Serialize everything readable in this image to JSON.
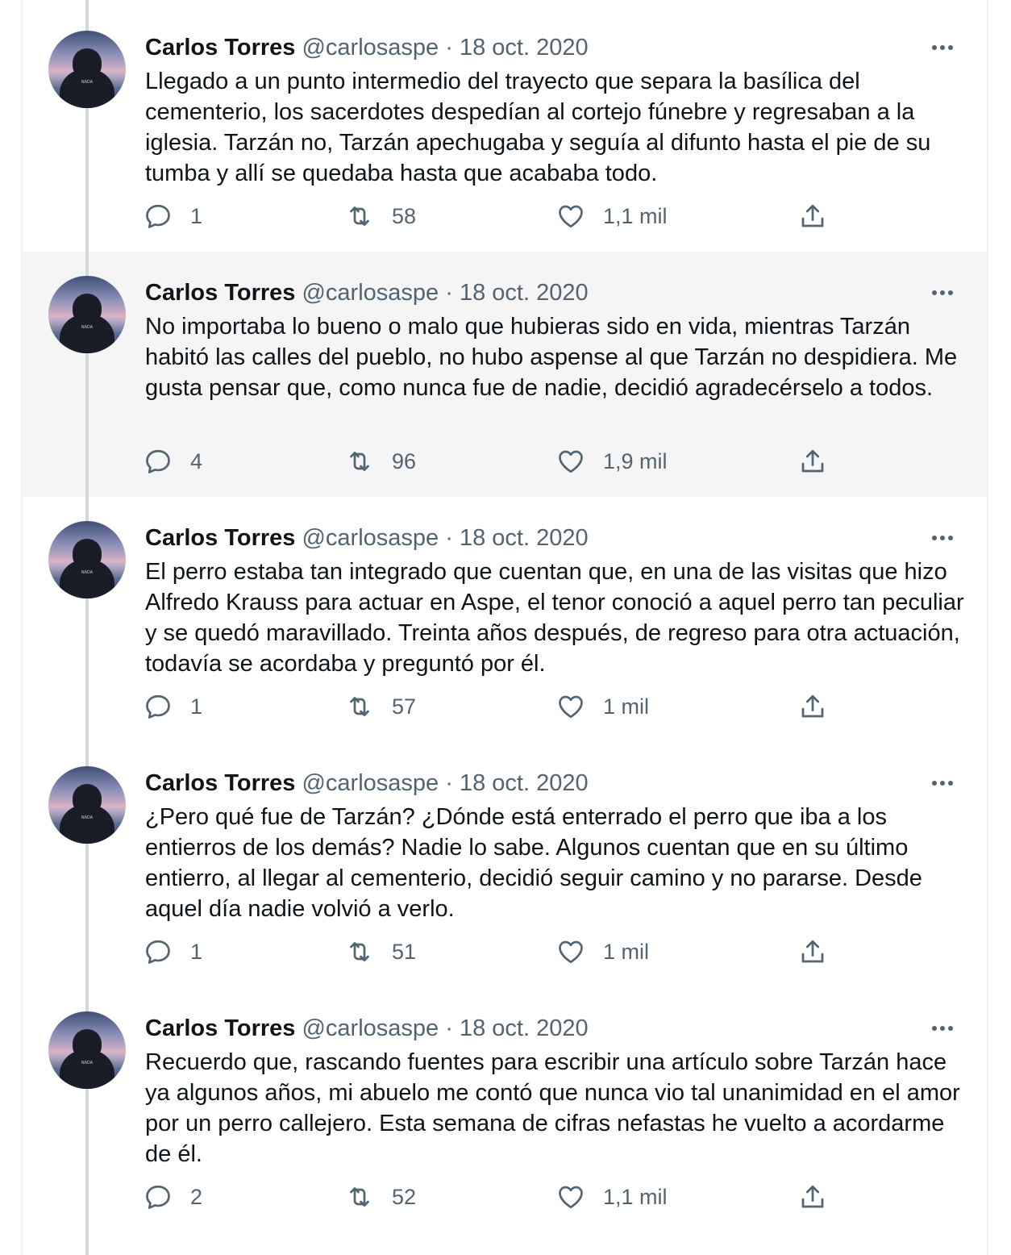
{
  "tweets": [
    {
      "name": "Carlos Torres",
      "handle": "@carlosaspe",
      "date": "18 oct. 2020",
      "text": "Llegado a un punto intermedio del trayecto que separa la basílica del cementerio, los sacerdotes despedían al cortejo fúnebre y regresaban a la iglesia. Tarzán no, Tarzán apechugaba y seguía al difunto hasta el pie de su tumba y allí se quedaba hasta que acababa todo.",
      "replies": "1",
      "retweets": "58",
      "likes": "1,1 mil"
    },
    {
      "name": "Carlos Torres",
      "handle": "@carlosaspe",
      "date": "18 oct. 2020",
      "text": "No importaba lo bueno o malo que hubieras sido en vida, mientras Tarzán habitó las calles del pueblo, no hubo aspense al que Tarzán no despidiera. Me gusta pensar que, como nunca fue de nadie, decidió agradecérselo a todos.",
      "replies": "4",
      "retweets": "96",
      "likes": "1,9 mil"
    },
    {
      "name": "Carlos Torres",
      "handle": "@carlosaspe",
      "date": "18 oct. 2020",
      "text": "El perro estaba tan integrado que cuentan que, en una de las visitas que hizo Alfredo Krauss para actuar en Aspe, el tenor conoció a aquel perro tan peculiar y se quedó maravillado. Treinta años después, de regreso para otra actuación, todavía se acordaba y preguntó por él.",
      "replies": "1",
      "retweets": "57",
      "likes": "1 mil"
    },
    {
      "name": "Carlos Torres",
      "handle": "@carlosaspe",
      "date": "18 oct. 2020",
      "text": "¿Pero qué fue de Tarzán? ¿Dónde está enterrado el perro que iba a los entierros de los demás? Nadie lo sabe. Algunos cuentan que en su último entierro, al llegar al cementerio, decidió seguir camino y no pararse. Desde aquel día nadie volvió a verlo.",
      "replies": "1",
      "retweets": "51",
      "likes": "1 mil"
    },
    {
      "name": "Carlos Torres",
      "handle": "@carlosaspe",
      "date": "18 oct. 2020",
      "text": "Recuerdo que, rascando fuentes para escribir una artículo sobre Tarzán hace ya algunos años, mi abuelo me contó que nunca vio tal unanimidad en el amor por un perro callejero. Esta semana de cifras nefastas he vuelto a acordarme de él.",
      "replies": "2",
      "retweets": "52",
      "likes": "1,1 mil"
    }
  ],
  "separator": "·",
  "colors": {
    "text": "#0f1419",
    "secondary": "#536471",
    "thread_line": "#cfd9de",
    "highlight_bg": "#f5f5f5"
  },
  "icons": {
    "reply": "reply-icon",
    "retweet": "retweet-icon",
    "like": "heart-icon",
    "share": "share-icon",
    "more": "more-icon"
  }
}
